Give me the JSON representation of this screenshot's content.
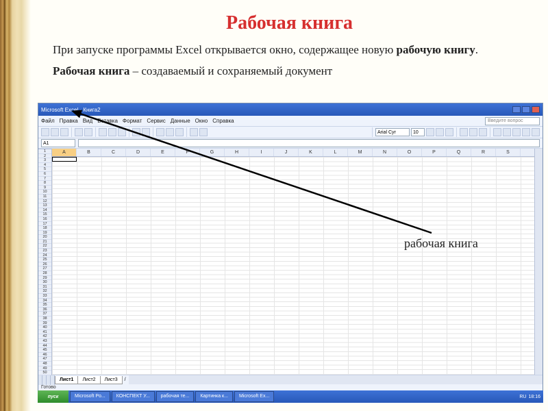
{
  "title": "Рабочая книга",
  "paragraph1_pre": "При запуске программы Excel открывается окно, содержащее новую ",
  "paragraph1_bold": "рабочую книгу",
  "paragraph1_post": ".",
  "paragraph2_bold": "Рабочая книга",
  "paragraph2_post": " – создаваемый и сохраняемый документ",
  "excel": {
    "app_title": "Microsoft Excel - Книга2",
    "menu": [
      "Файл",
      "Правка",
      "Вид",
      "Вставка",
      "Формат",
      "Сервис",
      "Данные",
      "Окно",
      "Справка"
    ],
    "question_hint": "Введите вопрос",
    "font_name": "Arial Cyr",
    "font_size": "10",
    "name_box": "A1",
    "columns": [
      "A",
      "B",
      "C",
      "D",
      "E",
      "F",
      "G",
      "H",
      "I",
      "J",
      "K",
      "L",
      "M",
      "N",
      "O",
      "P",
      "Q",
      "R",
      "S"
    ],
    "row_count": 50,
    "sheet_tabs": [
      "Лист1",
      "Лист2",
      "Лист3"
    ],
    "status": "Готово"
  },
  "annotation": "рабочая книга",
  "taskbar": {
    "start": "пуск",
    "items": [
      "Microsoft Po...",
      "КОНСПЕКТ У...",
      "рабочая те...",
      "Картинка к...",
      "Microsoft Ex..."
    ],
    "lang": "RU",
    "time": "18:16"
  }
}
